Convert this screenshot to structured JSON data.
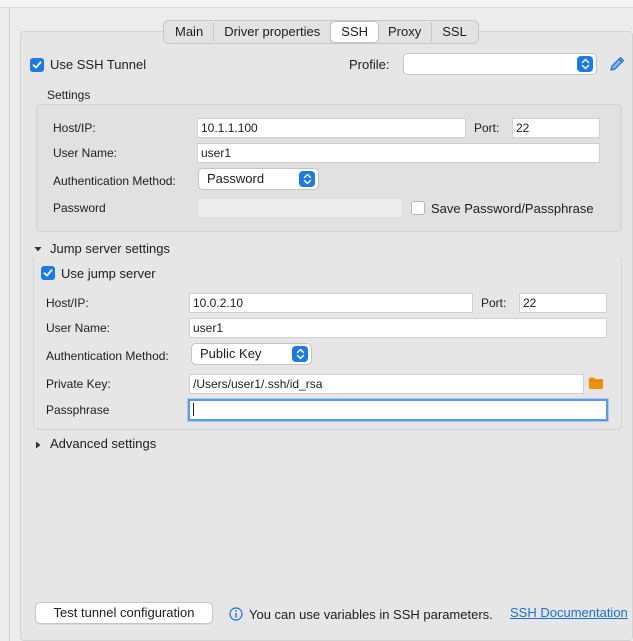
{
  "tabs": [
    {
      "label": "Main"
    },
    {
      "label": "Driver properties"
    },
    {
      "label": "SSH"
    },
    {
      "label": "Proxy"
    },
    {
      "label": "SSL"
    }
  ],
  "ssh": {
    "use_tunnel_label": "Use SSH Tunnel",
    "use_tunnel_checked": true,
    "profile_label": "Profile:",
    "profile_value": "",
    "settings_title": "Settings",
    "host_label": "Host/IP:",
    "host_value": "10.1.1.100",
    "port_label": "Port:",
    "port_value": "22",
    "user_label": "User Name:",
    "user_value": "user1",
    "auth_label": "Authentication Method:",
    "auth_value": "Password",
    "password_label": "Password",
    "password_value": "",
    "save_password_label": "Save Password/Passphrase",
    "save_password_checked": false
  },
  "jump": {
    "section_title": "Jump server settings",
    "use_label": "Use jump server",
    "use_checked": true,
    "host_label": "Host/IP:",
    "host_value": "10.0.2.10",
    "port_label": "Port:",
    "port_value": "22",
    "user_label": "User Name:",
    "user_value": "user1",
    "auth_label": "Authentication Method:",
    "auth_value": "Public Key",
    "key_label": "Private Key:",
    "key_value": "/Users/user1/.ssh/id_rsa",
    "passphrase_label": "Passphrase",
    "passphrase_value": ""
  },
  "advanced": {
    "title": "Advanced settings"
  },
  "footer": {
    "test_button": "Test tunnel configuration",
    "info_text": "You can use variables in SSH parameters.",
    "doc_link": "SSH Documentation"
  },
  "colors": {
    "accent": "#1b7ae8",
    "link": "#1b6ed3",
    "folder": "#f0900c"
  }
}
